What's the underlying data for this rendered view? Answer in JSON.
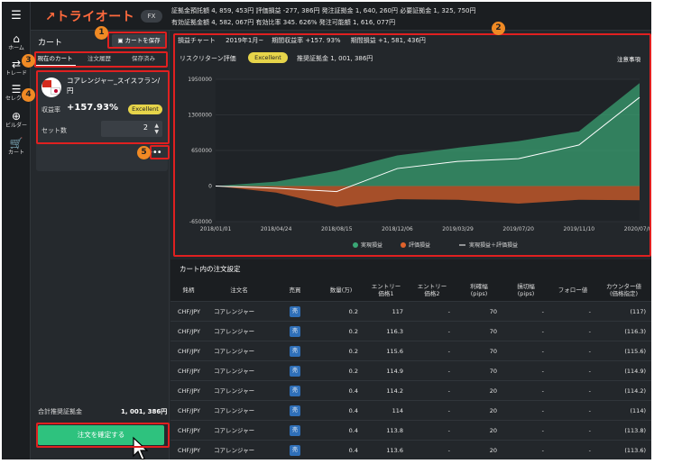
{
  "app": {
    "logo": "トライオート",
    "mode": "FX",
    "menu_icon": "hamburger-icon"
  },
  "account": {
    "row1": "証拠金預託額 4, 859, 453円  評価損益 -277, 386円  発注証拠金 1, 640, 260円  必要証拠金 1, 325, 750円",
    "row2": "有効証拠金額 4, 582, 067円  有効比率  345. 626%  発注可能額 1, 616, 077円"
  },
  "rail": [
    {
      "icon": "home-icon",
      "glyph": "⌂",
      "label": "ホーム"
    },
    {
      "icon": "trade-icon",
      "glyph": "⇄",
      "label": "トレード"
    },
    {
      "icon": "select-icon",
      "glyph": "☰",
      "label": "セレクト"
    },
    {
      "icon": "builder-icon",
      "glyph": "⊕",
      "label": "ビルダー"
    },
    {
      "icon": "cart-icon",
      "glyph": "🛒",
      "label": "カート"
    }
  ],
  "cart": {
    "title": "カート",
    "save_label": "カートを保存",
    "tabs": [
      "現在のカート",
      "注文履歴",
      "保存済み"
    ],
    "strategy": "コアレンジャー_スイスフラン/円",
    "return_label": "収益率",
    "return_value": "+157.93%",
    "rating": "Excellent",
    "sets_label": "セット数",
    "sets_value": "2",
    "more": "•••",
    "total_label": "合計推奨証拠金",
    "total_value": "1, 001, 386円",
    "confirm_label": "注文を確定する"
  },
  "chart_header": {
    "title": "損益チャート",
    "period": "2019年1月~",
    "period_return": "期間収益率 +157. 93%",
    "period_pl": "期間損益 +1, 581, 436円",
    "risk_label": "リスクリターン評価",
    "risk_badge": "Excellent",
    "rec_margin": "推奨証拠金  1, 001, 386円",
    "notes": "注意事項"
  },
  "chart_data": {
    "type": "area",
    "x": [
      "2018/01/01",
      "2018/04/24",
      "2018/08/15",
      "2018/12/06",
      "2019/03/29",
      "2019/07/20",
      "2019/11/10",
      "2020/07/06"
    ],
    "ylim": [
      -650000,
      1950000
    ],
    "y_ticks": [
      "1950000",
      "1300000",
      "650000",
      "0",
      "-650000"
    ],
    "series": [
      {
        "name": "実現損益",
        "color": "#3aa876",
        "values": [
          0,
          80000,
          280000,
          560000,
          700000,
          820000,
          1000000,
          1880000
        ]
      },
      {
        "name": "評価損益",
        "color": "#e0622b",
        "values": [
          0,
          -120000,
          -380000,
          -240000,
          -250000,
          -320000,
          -250000,
          -260000
        ]
      },
      {
        "name": "実現損益＋評価損益",
        "color": "#ffffff",
        "values": [
          0,
          -40000,
          -100000,
          320000,
          450000,
          500000,
          750000,
          1620000
        ]
      }
    ],
    "legend": "bottom"
  },
  "table": {
    "title": "カート内の注文設定",
    "headers": [
      "銘柄",
      "注文名",
      "売買",
      "数量(万)",
      "エントリー\n価格1",
      "エントリー\n価格2",
      "利確幅\n(pips)",
      "損切幅\n(pips)",
      "フォロー値",
      "カウンター値\n(価格指定)"
    ],
    "side": "売",
    "rows": [
      [
        "CHF/JPY",
        "コアレンジャー",
        "売",
        "0.2",
        "117",
        "-",
        "70",
        "-",
        "-",
        "(117)"
      ],
      [
        "CHF/JPY",
        "コアレンジャー",
        "売",
        "0.2",
        "116.3",
        "-",
        "70",
        "-",
        "-",
        "(116.3)"
      ],
      [
        "CHF/JPY",
        "コアレンジャー",
        "売",
        "0.2",
        "115.6",
        "-",
        "70",
        "-",
        "-",
        "(115.6)"
      ],
      [
        "CHF/JPY",
        "コアレンジャー",
        "売",
        "0.2",
        "114.9",
        "-",
        "70",
        "-",
        "-",
        "(114.9)"
      ],
      [
        "CHF/JPY",
        "コアレンジャー",
        "売",
        "0.4",
        "114.2",
        "-",
        "20",
        "-",
        "-",
        "(114.2)"
      ],
      [
        "CHF/JPY",
        "コアレンジャー",
        "売",
        "0.4",
        "114",
        "-",
        "20",
        "-",
        "-",
        "(114)"
      ],
      [
        "CHF/JPY",
        "コアレンジャー",
        "売",
        "0.4",
        "113.8",
        "-",
        "20",
        "-",
        "-",
        "(113.8)"
      ],
      [
        "CHF/JPY",
        "コアレンジャー",
        "売",
        "0.4",
        "113.6",
        "-",
        "20",
        "-",
        "-",
        "(113.6)"
      ]
    ]
  },
  "annotations": [
    "1",
    "2",
    "3",
    "4",
    "5"
  ],
  "colors": {
    "accent": "#ff6a3d",
    "excellent": "#e6d44a",
    "confirm": "#2ec27e",
    "annotation": "#e02020",
    "marker": "#f08a24"
  }
}
